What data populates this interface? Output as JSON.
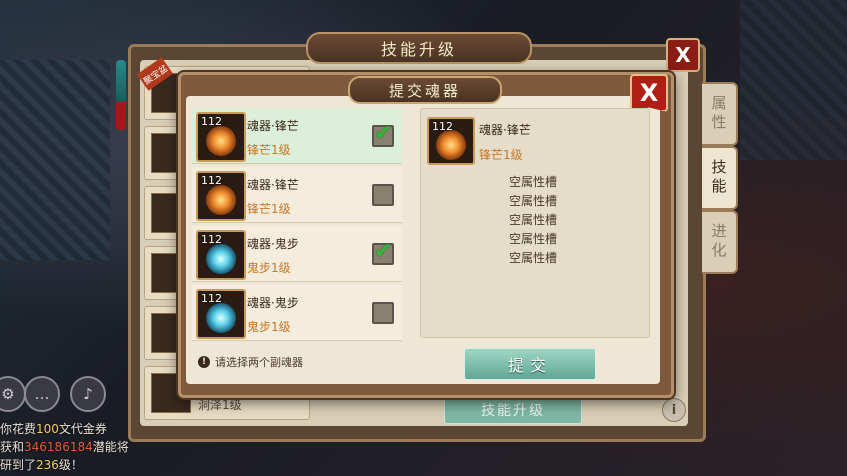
{
  "background": {
    "back_panel": {
      "title": "技能升级",
      "close_label": "X",
      "badge": "聚宝盆",
      "tabs": [
        {
          "label": "属性",
          "active": false
        },
        {
          "label": "技能",
          "active": true
        },
        {
          "label": "进化",
          "active": false
        }
      ],
      "bottom_label": "洞泽1级",
      "upgrade_button": "技能升级",
      "info_label": "i"
    },
    "chat": {
      "lines": [
        {
          "a": "你花费",
          "b": "100",
          "c": "文代金券"
        },
        {
          "a": "获和",
          "b": "346186184",
          "c": "潜能将"
        },
        {
          "a": "研到了",
          "b": "236",
          "c": "级！"
        }
      ]
    }
  },
  "dialog": {
    "title": "提交魂器",
    "close_label": "X",
    "items": [
      {
        "level": "112",
        "name": "魂器·锋芒",
        "sub": "锋芒1级",
        "type": "fire",
        "checked": true,
        "check_glyph": "✔"
      },
      {
        "level": "112",
        "name": "魂器·锋芒",
        "sub": "锋芒1级",
        "type": "fire",
        "checked": false,
        "check_glyph": ""
      },
      {
        "level": "112",
        "name": "魂器·鬼步",
        "sub": "鬼步1级",
        "type": "ice",
        "checked": true,
        "check_glyph": "✔"
      },
      {
        "level": "112",
        "name": "魂器·鬼步",
        "sub": "鬼步1级",
        "type": "ice",
        "checked": false,
        "check_glyph": ""
      }
    ],
    "hint": "请选择两个副魂器",
    "hint_icon": "!",
    "detail": {
      "level": "112",
      "name": "魂器·锋芒",
      "sub": "锋芒1级",
      "slots": [
        "空属性槽",
        "空属性槽",
        "空属性槽",
        "空属性槽",
        "空属性槽"
      ]
    },
    "submit_label": "提交"
  }
}
